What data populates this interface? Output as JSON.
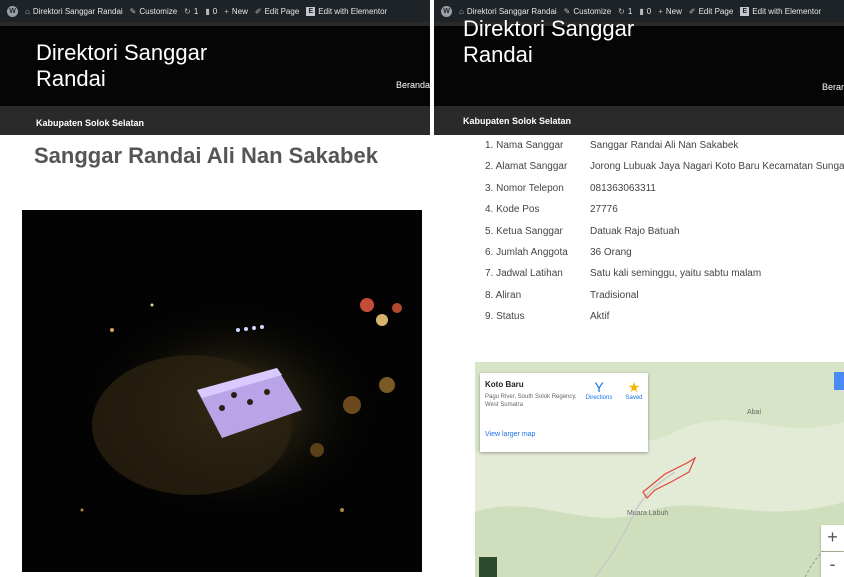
{
  "left_panel": {
    "admin_bar": {
      "site_name": "Direktori Sanggar Randai",
      "customize": "Customize",
      "updates_count": "1",
      "comments_count": "0",
      "new": "New",
      "edit_page": "Edit Page",
      "edit_elementor": "Edit with Elementor"
    },
    "site_title_line1": "Direktori Sanggar",
    "site_title_line2": "Randai",
    "tagline": "Kabupaten Solok Selatan",
    "nav_item": "Beranda",
    "page_title": "Sanggar Randai Ali Nan Sakabek"
  },
  "right_panel": {
    "admin_bar": {
      "site_name": "Direktori Sanggar Randai",
      "customize": "Customize",
      "updates_count": "1",
      "comments_count": "0",
      "new": "New",
      "edit_page": "Edit Page",
      "edit_elementor": "Edit with Elementor"
    },
    "site_title_line1": "Direktori Sanggar",
    "site_title_line2": "Randai",
    "tagline": "Kabupaten Solok Selatan",
    "nav_item": "Beranc",
    "details": [
      {
        "label": "1. Nama Sanggar",
        "value": "Sanggar Randai Ali Nan Sakabek"
      },
      {
        "label": "2. Alamat Sanggar",
        "value": "Jorong Lubuak Jaya Nagari Koto Baru Kecamatan Sungai Pagu"
      },
      {
        "label": "3. Nomor Telepon",
        "value": " 081363063311"
      },
      {
        "label": "4. Kode Pos",
        "value": "27776"
      },
      {
        "label": "5. Ketua Sanggar",
        "value": "Datuak Rajo Batuah"
      },
      {
        "label": "6. Jumlah Anggota",
        "value": " 36 Orang"
      },
      {
        "label": "7. Jadwal Latihan",
        "value": "Satu kali seminggu, yaitu sabtu malam"
      },
      {
        "label": "8. Aliran",
        "value": "Tradisional"
      },
      {
        "label": "9. Status",
        "value": "Aktif"
      }
    ],
    "map": {
      "place_name": "Koto Baru",
      "address": "Pagu River, South Solok Regency, West Sumatra",
      "directions": "Directions",
      "saved": "Saved",
      "view_larger": "View larger map",
      "label_abai": "Abai",
      "label_muara_labuh": "Muara Labuh",
      "zoom_in": "+",
      "zoom_out": "-"
    }
  },
  "colors": {
    "admin_bar": "#1d2327",
    "header": "#2a2a2a",
    "link": "#1a73e8",
    "boundary": "#e0453a"
  }
}
